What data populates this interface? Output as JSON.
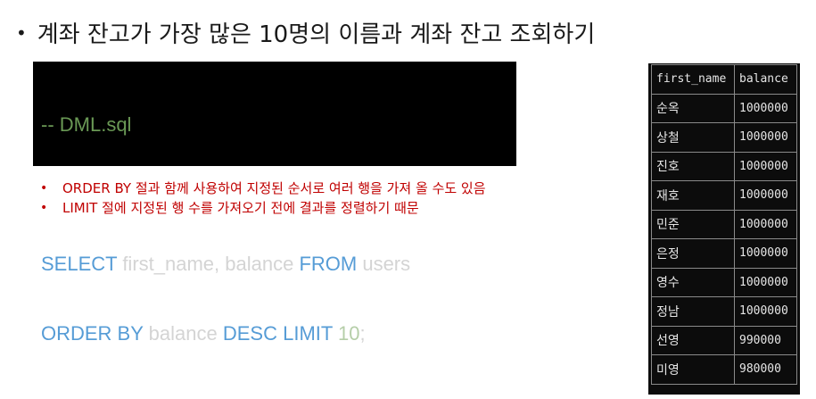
{
  "heading": {
    "bullet": "•",
    "text": "계좌 잔고가 가장 많은 10명의 이름과 계좌 잔고 조회하기"
  },
  "code": {
    "comment": "-- DML.sql",
    "line1": {
      "select": "SELECT",
      "cols": "first_name, balance",
      "from": "FROM",
      "table": "users"
    },
    "line2": {
      "order_by": "ORDER BY",
      "col": "balance",
      "desc": "DESC",
      "limit": "LIMIT",
      "num": "10",
      "semi": ";"
    }
  },
  "notes": [
    {
      "bullet": "•",
      "text": "ORDER BY 절과 함께 사용하여 지정된 순서로 여러 행을 가져 올 수도 있음"
    },
    {
      "bullet": "•",
      "text": "LIMIT 절에 지정된 행 수를 가져오기 전에 결과를 정렬하기 때문"
    }
  ],
  "result_table": {
    "columns": [
      "first_name",
      "balance"
    ],
    "rows": [
      [
        "순옥",
        "1000000"
      ],
      [
        "상철",
        "1000000"
      ],
      [
        "진호",
        "1000000"
      ],
      [
        "재호",
        "1000000"
      ],
      [
        "민준",
        "1000000"
      ],
      [
        "은정",
        "1000000"
      ],
      [
        "영수",
        "1000000"
      ],
      [
        "정남",
        "1000000"
      ],
      [
        "선영",
        "990000"
      ],
      [
        "미영",
        "980000"
      ]
    ]
  }
}
